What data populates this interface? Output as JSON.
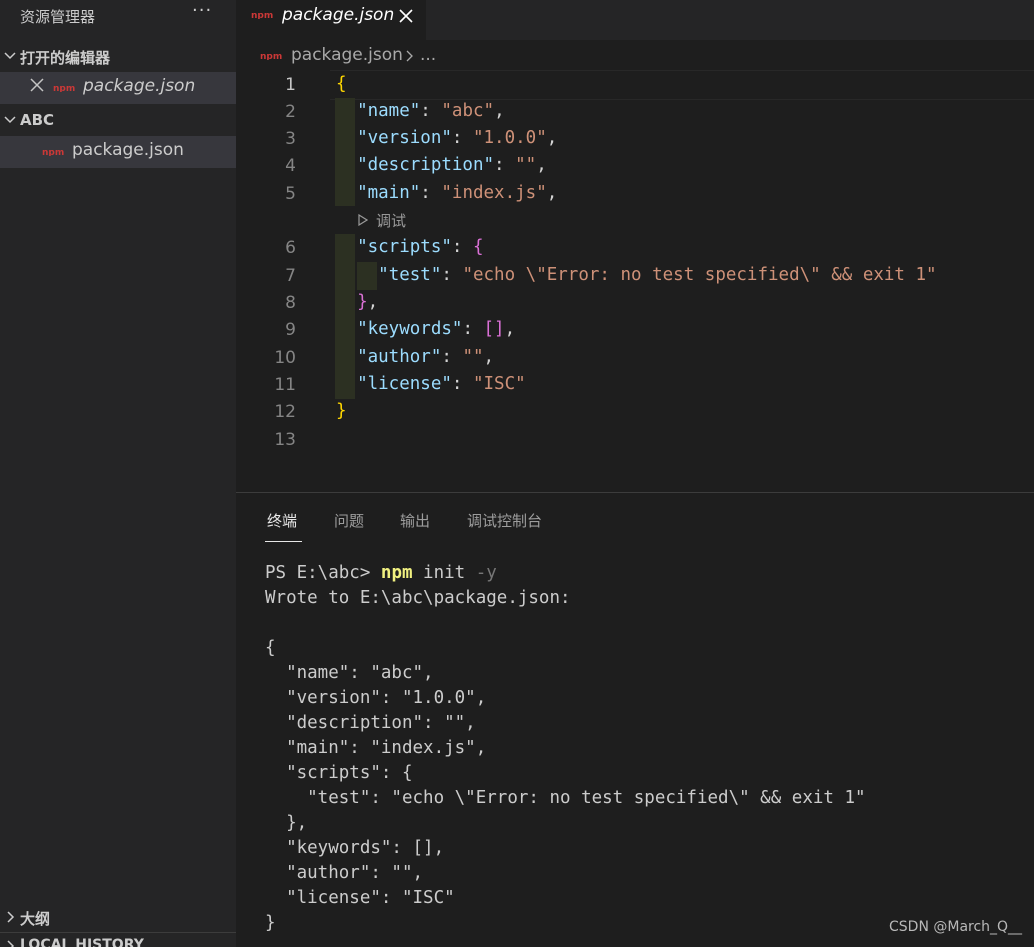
{
  "sidebar": {
    "title": "资源管理器",
    "more": "···",
    "open_editors_label": "打开的编辑器",
    "open_editor_file": "package.json",
    "folder_label": "ABC",
    "folder_file": "package.json",
    "outline_label": "大纲",
    "local_history_label": "LOCAL HISTORY"
  },
  "tab": {
    "filename": "package.json"
  },
  "breadcrumb": {
    "file": "package.json",
    "more": "..."
  },
  "editor": {
    "line_numbers": [
      "1",
      "2",
      "3",
      "4",
      "5",
      "6",
      "7",
      "8",
      "9",
      "10",
      "11",
      "12",
      "13"
    ],
    "codelens": "调试",
    "lines": {
      "l1": "{",
      "l2k": "\"name\"",
      "l2v": "\"abc\"",
      "l3k": "\"version\"",
      "l3v": "\"1.0.0\"",
      "l4k": "\"description\"",
      "l4v": "\"\"",
      "l5k": "\"main\"",
      "l5v": "\"index.js\"",
      "l6k": "\"scripts\"",
      "l6b": "{",
      "l7k": "\"test\"",
      "l7v": "\"echo \\\"Error: no test specified\\\" && exit 1\"",
      "l8b": "}",
      "l9k": "\"keywords\"",
      "l9b": "[]",
      "l10k": "\"author\"",
      "l10v": "\"\"",
      "l11k": "\"license\"",
      "l11v": "\"ISC\"",
      "l12": "}"
    }
  },
  "panel": {
    "tabs": [
      "终端",
      "问题",
      "输出",
      "调试控制台"
    ],
    "active_tab": "终端",
    "prompt": "PS E:\\abc> ",
    "cmd": "npm",
    "cmd_arg": " init ",
    "cmd_flag": "-y",
    "output": [
      "Wrote to E:\\abc\\package.json:",
      "",
      "{",
      "  \"name\": \"abc\",",
      "  \"version\": \"1.0.0\",",
      "  \"description\": \"\",",
      "  \"main\": \"index.js\",",
      "  \"scripts\": {",
      "    \"test\": \"echo \\\"Error: no test specified\\\" && exit 1\"",
      "  },",
      "  \"keywords\": [],",
      "  \"author\": \"\",",
      "  \"license\": \"ISC\"",
      "}"
    ]
  },
  "watermark": "CSDN @March_Q__",
  "colors": {
    "editor_bg": "#1e1e1e",
    "sidebar_bg": "#252526",
    "json_key": "#9cdcfe",
    "json_string": "#ce9178",
    "bracket_gold": "#ffd700",
    "bracket_purple": "#da70d6",
    "npm_red": "#cb3837"
  },
  "icons": [
    "npm-icon",
    "close-icon",
    "chevron-down-icon",
    "chevron-right-icon",
    "play-icon",
    "more-icon"
  ]
}
